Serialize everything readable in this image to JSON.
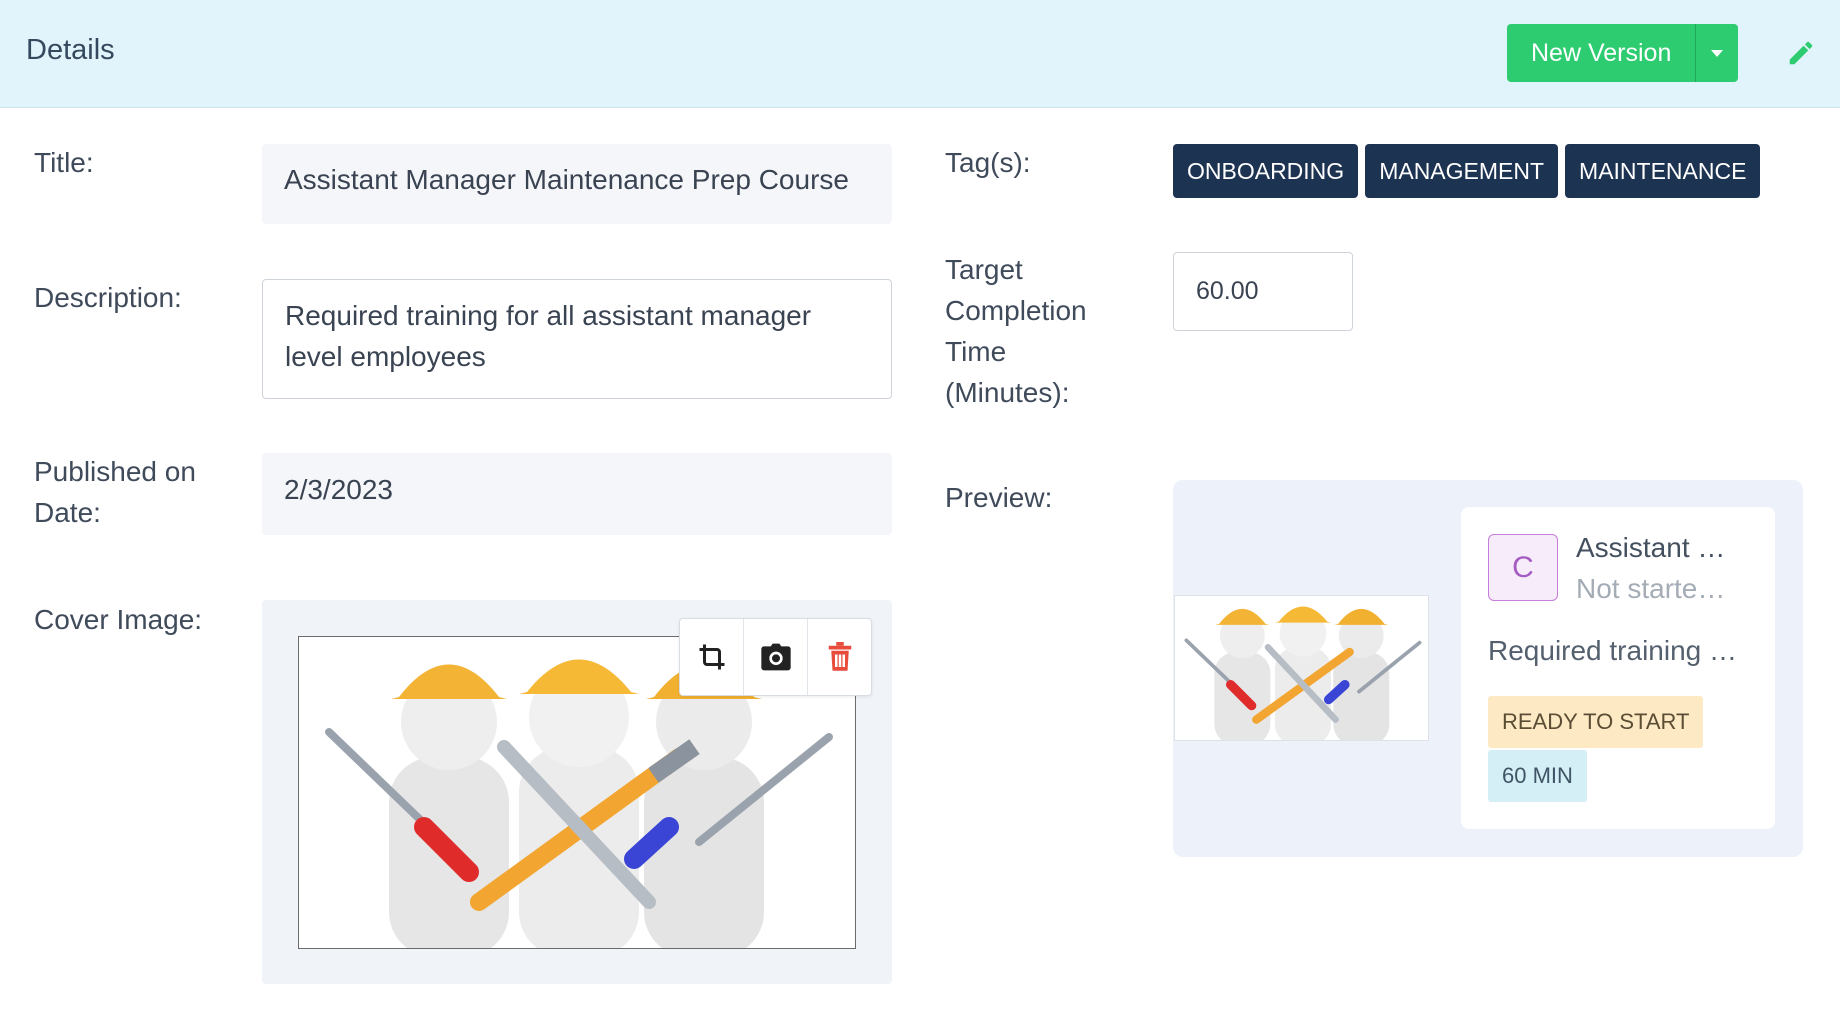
{
  "header": {
    "title": "Details",
    "new_version_label": "New Version"
  },
  "form": {
    "title_label": "Title:",
    "title_value": "Assistant Manager Maintenance Prep Course",
    "description_label": "Description:",
    "description_value": "Required training for all assistant manager level employees",
    "published_label_1": "Published on",
    "published_label_2": "Date:",
    "published_value": "2/3/2023",
    "cover_label": "Cover Image:",
    "tags_label": "Tag(s):",
    "tags": [
      "ONBOARDING",
      "MANAGEMENT",
      "MAINTENANCE"
    ],
    "target_label_1": "Target",
    "target_label_2": "Completion",
    "target_label_3": "Time",
    "target_label_4": "(Minutes):",
    "target_value": "60.00",
    "preview_label": "Preview:"
  },
  "preview_card": {
    "avatar_letter": "C",
    "title": "Assistant …",
    "status": "Not starte…",
    "description": "Required training …",
    "badge_status": "READY TO START",
    "badge_time": "60 MIN"
  },
  "colors": {
    "accent_green": "#2ecc71",
    "tag_navy": "#1d3352",
    "header_bg": "#e1f3fb",
    "delete_red": "#e74c3c"
  },
  "icons": {
    "edit": "pencil-icon",
    "dropdown": "caret-down-icon",
    "crop": "crop-icon",
    "camera": "camera-icon",
    "delete": "trash-icon"
  }
}
